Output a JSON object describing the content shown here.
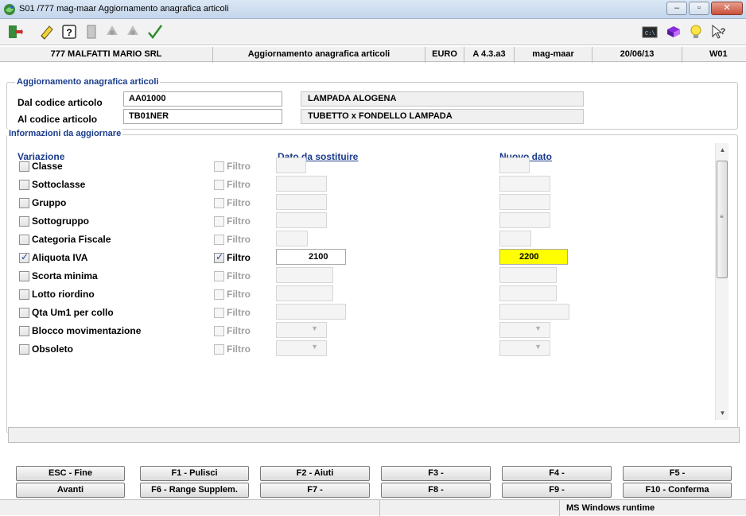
{
  "window": {
    "title": "S01 /777 mag-maar Aggiornamento anagrafica articoli"
  },
  "toolbar": {
    "icons": [
      "exit-icon",
      "eraser-icon",
      "help-icon",
      "document-icon",
      "recycle-icon",
      "recycle-icon",
      "checkmark-icon",
      "terminal-icon",
      "book-icon",
      "lightbulb-icon",
      "context-help-icon"
    ]
  },
  "infobar": {
    "company": "777 MALFATTI MARIO SRL",
    "function": "Aggiornamento anagrafica articoli",
    "currency": "EURO",
    "version": "A 4.3.a3",
    "program": "mag-maar",
    "date": "20/06/13",
    "workstation": "W01"
  },
  "range": {
    "group_title": "Aggiornamento anagrafica articoli",
    "from_label": "Dal codice articolo",
    "from_code": "AA01000",
    "from_desc": "LAMPADA ALOGENA",
    "to_label": "Al  codice articolo",
    "to_code": "TB01NER",
    "to_desc": "TUBETTO x FONDELLO LAMPADA"
  },
  "update": {
    "group_title": "Informazioni da aggiornare",
    "col_variation": "Variazione",
    "col_old": "Dato da sostituire",
    "col_new": "Nuovo dato",
    "filter_label": "Filtro",
    "rows": [
      {
        "label": "Classe",
        "checked": false,
        "filter_checked": false,
        "old": "",
        "new": ""
      },
      {
        "label": "Sottoclasse",
        "checked": false,
        "filter_checked": false,
        "old": "",
        "new": ""
      },
      {
        "label": "Gruppo",
        "checked": false,
        "filter_checked": false,
        "old": "",
        "new": ""
      },
      {
        "label": "Sottogruppo",
        "checked": false,
        "filter_checked": false,
        "old": "",
        "new": ""
      },
      {
        "label": "Categoria Fiscale",
        "checked": false,
        "filter_checked": false,
        "old": "",
        "new": ""
      },
      {
        "label": "Aliquota IVA",
        "checked": true,
        "filter_checked": true,
        "old": "2100",
        "new": "2200"
      },
      {
        "label": "Scorta minima",
        "checked": false,
        "filter_checked": false,
        "old": "",
        "new": ""
      },
      {
        "label": "Lotto riordino",
        "checked": false,
        "filter_checked": false,
        "old": "",
        "new": ""
      },
      {
        "label": "Qta Um1 per collo",
        "checked": false,
        "filter_checked": false,
        "old": "",
        "new": ""
      },
      {
        "label": "Blocco movimentazione",
        "checked": false,
        "filter_checked": false,
        "old": "",
        "new": ""
      },
      {
        "label": "Obsoleto",
        "checked": false,
        "filter_checked": false,
        "old": "",
        "new": ""
      }
    ]
  },
  "fkeys": {
    "row1": [
      "ESC - Fine",
      "F1 - Pulisci",
      "F2 - Aiuti",
      "F3 -",
      "F4 -",
      "F5 -"
    ],
    "row2": [
      "Avanti",
      "F6 - Range Supplem.",
      "F7 -",
      "F8 -",
      "F9 -",
      "F10 - Conferma"
    ]
  },
  "status": {
    "runtime": "MS Windows runtime"
  }
}
